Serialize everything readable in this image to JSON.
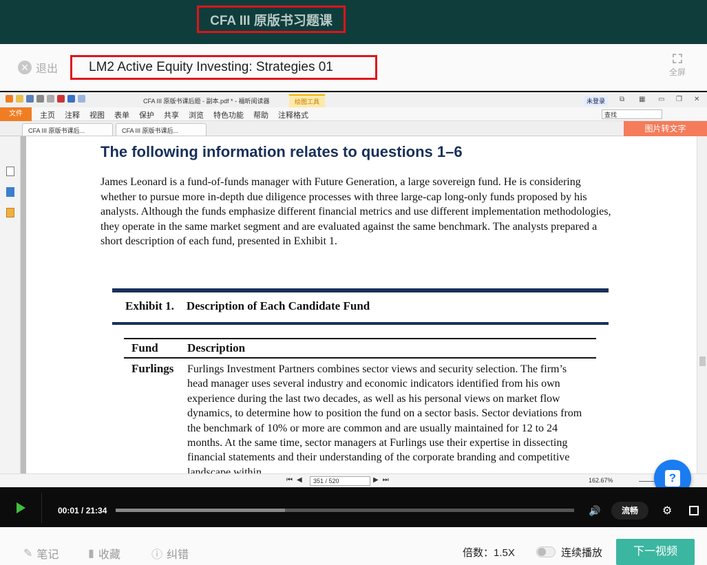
{
  "banner": {
    "title": "CFA III 原版书习题课"
  },
  "lesson": {
    "exit_label": "退出",
    "title": "LM2 Active Equity Investing: Strategies 01",
    "fullscreen_label": "全屏"
  },
  "reader": {
    "doc_title": "CFA III 原版书课后题 - 副本.pdf * - 福昕阅读器",
    "drawing_tools": "绘图工具",
    "not_logged_in": "未登录",
    "search_value": "查找",
    "menu": [
      "文件",
      "主页",
      "注释",
      "视图",
      "表单",
      "保护",
      "共享",
      "浏览",
      "特色功能",
      "帮助",
      "注释格式"
    ],
    "tabs": [
      "CFA III 原版书课后...",
      "CFA III 原版书课后..."
    ],
    "image_to_text": "图片转文字",
    "page_indicator": "351 / 520",
    "zoom": "162.67%"
  },
  "document": {
    "heading": "The following information relates to questions 1–6",
    "intro": "James Leonard is a fund-of-funds manager with Future Generation, a large sovereign fund. He is considering whether to pursue more in-depth due diligence processes with three large-cap long-only funds proposed by his analysts. Although the funds emphasize different financial metrics and use different implementation methodologies, they operate in the same market segment and are evaluated against the same benchmark. The analysts prepared a short description of each fund, presented in Exhibit 1.",
    "exhibit_label": "Exhibit 1.",
    "exhibit_title": "Description of Each Candidate Fund",
    "col_fund": "Fund",
    "col_description": "Description",
    "fund_name": "Furlings",
    "fund_description": "Furlings Investment Partners combines sector views and security selection. The firm’s head manager uses several industry and economic indicators identified from his own experience during the last two decades, as well as his personal views on market flow dynamics, to determine how to position the fund on a sector basis. Sector deviations from the benchmark of 10% or more are common and are usually maintained for 12 to 24 months. At the same time, sector managers at Furlings use their expertise in dissecting financial statements and their understanding of the corporate branding and competitive landscape within"
  },
  "player": {
    "time": "00:01 / 21:34",
    "progress_fraction": 0.37,
    "speed_mode": "流畅"
  },
  "bottom": {
    "notes": "笔记",
    "favorite": "收藏",
    "report_error": "纠错",
    "speed": "倍数：1.5X",
    "autoplay": "连续播放",
    "next_video": "下一视频"
  },
  "colors": {
    "banner_bg": "#0f3d3b",
    "highlight_border": "#e0131b",
    "accent": "#3bb6a0",
    "help": "#1a7cf0",
    "play": "#3fbe3f"
  }
}
